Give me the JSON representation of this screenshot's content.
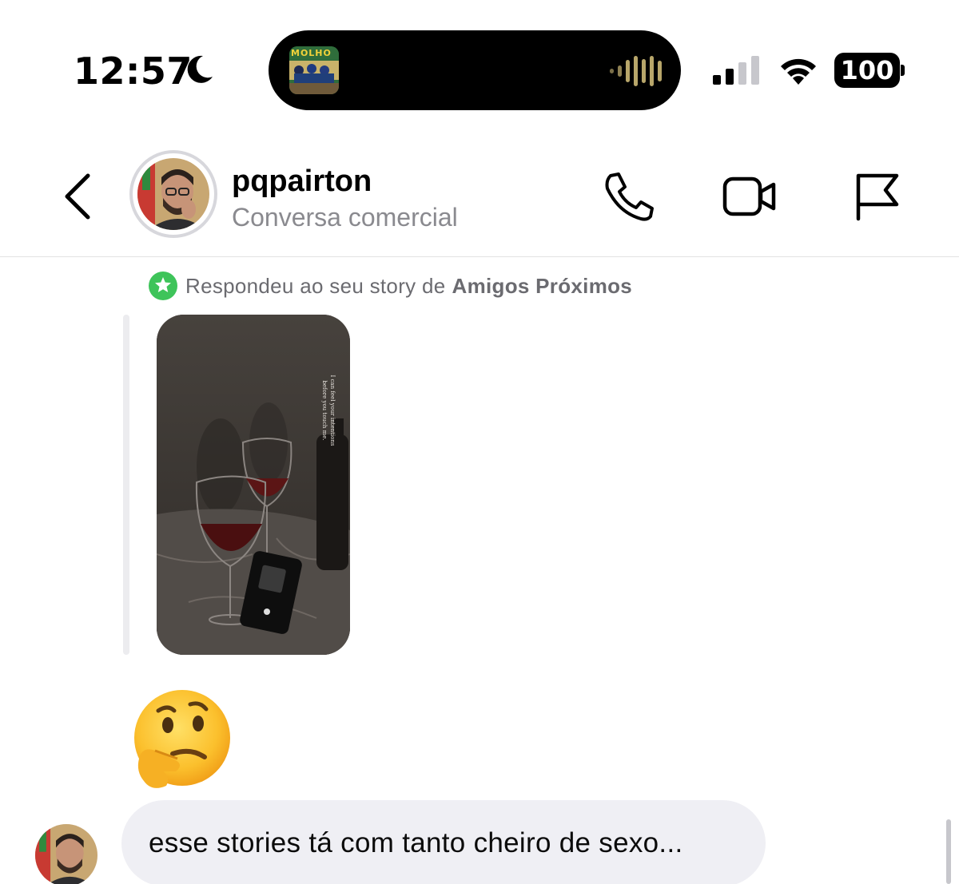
{
  "status_bar": {
    "time": "12:57",
    "battery": "100",
    "album_title": "MOLHO",
    "icons": [
      "moon-icon",
      "signal-icon",
      "wifi-icon",
      "battery-icon"
    ]
  },
  "header": {
    "username": "pqpairton",
    "subtitle": "Conversa comercial",
    "actions": [
      "phone-icon",
      "video-call-icon",
      "flag-icon"
    ]
  },
  "reply": {
    "prefix": "Respondeu ao seu story de",
    "audience": "Amigos Próximos"
  },
  "story": {
    "caption_line1": "I can feel your intentions",
    "caption_line2": "before you touch me."
  },
  "reaction_emoji": "thinking-face",
  "message": {
    "text": "esse stories tá com tanto cheiro de sexo..."
  },
  "colors": {
    "close_friends_green": "#3ec45a",
    "bubble_bg": "#efeff4",
    "subtitle_gray": "#8a8a8f"
  }
}
